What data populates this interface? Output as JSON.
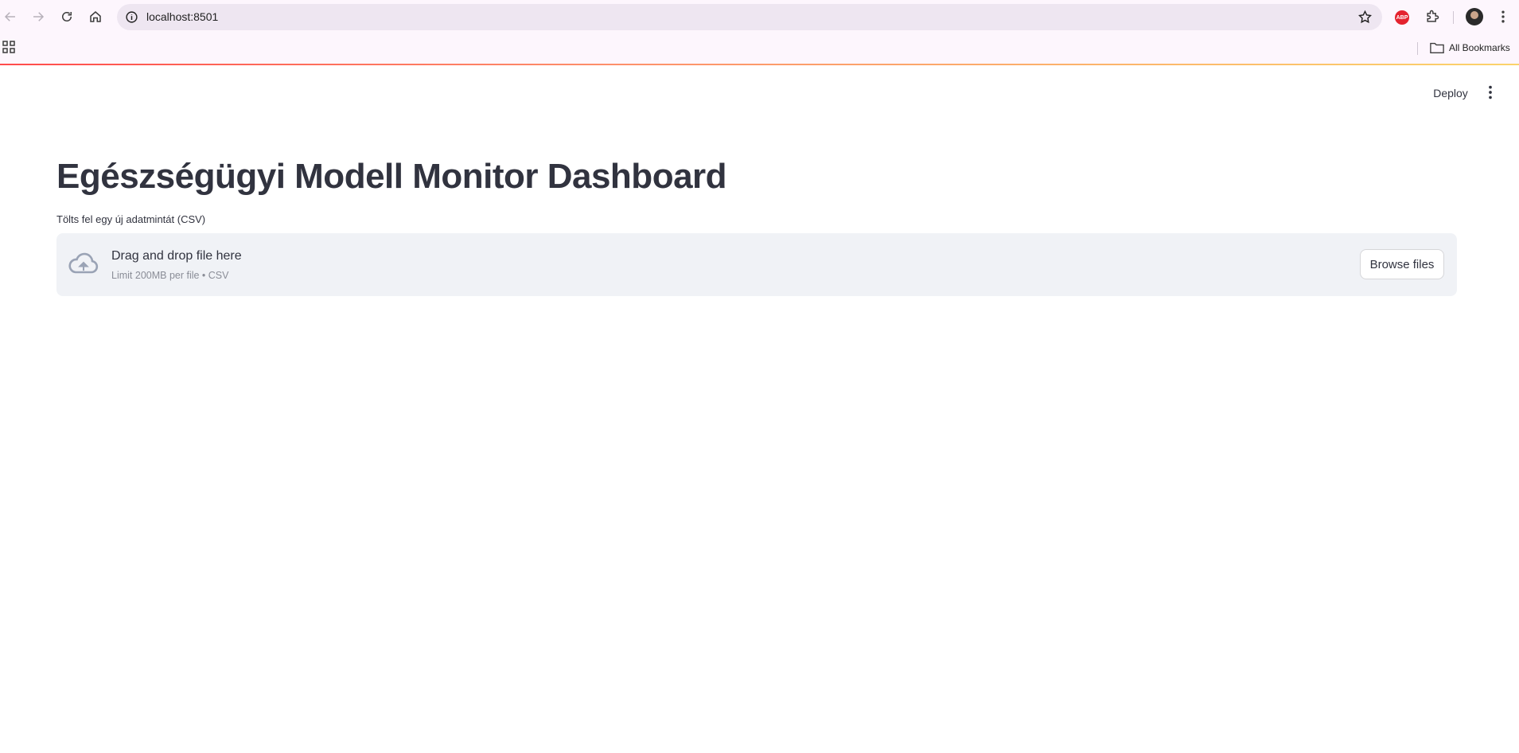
{
  "browser": {
    "url": "localhost:8501",
    "icons": [
      "back-icon",
      "forward-icon",
      "reload-icon",
      "home-icon",
      "info-icon",
      "star-icon",
      "adblock-icon",
      "extensions-icon",
      "avatar",
      "menu-icon"
    ],
    "adblock_label": "ABP",
    "bookmarks": {
      "all_bookmarks_label": "All Bookmarks"
    }
  },
  "app": {
    "deploy_label": "Deploy",
    "title": "Egészségügyi Modell Monitor Dashboard",
    "uploader": {
      "label": "Tölts fel egy új adatmintát (CSV)",
      "drop_title": "Drag and drop file here",
      "drop_subtitle": "Limit 200MB per file • CSV",
      "browse_label": "Browse files"
    }
  },
  "colors": {
    "accent": "#ff4b4b",
    "text": "#31333f",
    "dropzone_bg": "#f0f2f6",
    "browser_bar": "#fdf6fd"
  }
}
